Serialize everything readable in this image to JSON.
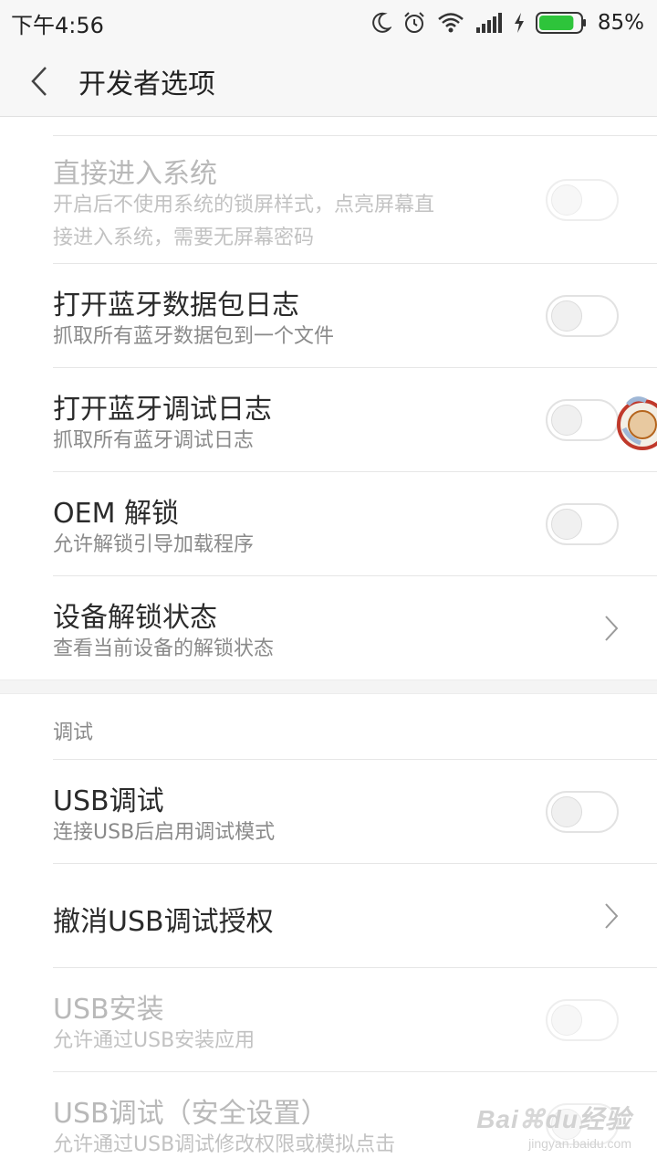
{
  "status_bar": {
    "time": "下午4:56",
    "battery_percent": "85%",
    "battery_level": 0.85,
    "battery_color": "#2ec43b",
    "icons": [
      "moon-icon",
      "alarm-icon",
      "wifi-icon",
      "signal-icon",
      "charging-icon",
      "battery-icon"
    ]
  },
  "header": {
    "title": "开发者选项",
    "back_icon": "chevron-left-icon"
  },
  "items": [
    {
      "title": "直接进入系统",
      "desc_line1": "开启后不使用系统的锁屏样式，点亮屏幕直",
      "desc_line2": "接进入系统，需要无屏幕密码",
      "control": "toggle",
      "on": false,
      "disabled": true
    },
    {
      "title": "打开蓝牙数据包日志",
      "desc": "抓取所有蓝牙数据包到一个文件",
      "control": "toggle",
      "on": false,
      "disabled": false
    },
    {
      "title": "打开蓝牙调试日志",
      "desc": "抓取所有蓝牙调试日志",
      "control": "toggle",
      "on": false,
      "disabled": false
    },
    {
      "title": "OEM 解锁",
      "desc": "允许解锁引导加载程序",
      "control": "toggle",
      "on": false,
      "disabled": false
    },
    {
      "title": "设备解锁状态",
      "desc": "查看当前设备的解锁状态",
      "control": "chevron",
      "disabled": false
    }
  ],
  "debug_section": {
    "header": "调试",
    "items": [
      {
        "title": "USB调试",
        "desc": "连接USB后启用调试模式",
        "control": "toggle",
        "on": false,
        "disabled": false
      },
      {
        "title": "撤消USB调试授权",
        "control": "chevron",
        "disabled": false
      },
      {
        "title": "USB安装",
        "desc": "允许通过USB安装应用",
        "control": "toggle",
        "on": false,
        "disabled": true
      },
      {
        "title": "USB调试（安全设置）",
        "desc": "允许通过USB调试修改权限或模拟点击",
        "control": "toggle",
        "on": false,
        "disabled": true
      }
    ]
  },
  "watermark": {
    "logo": "Baidu经验",
    "url": "jingyan.baidu.com"
  }
}
